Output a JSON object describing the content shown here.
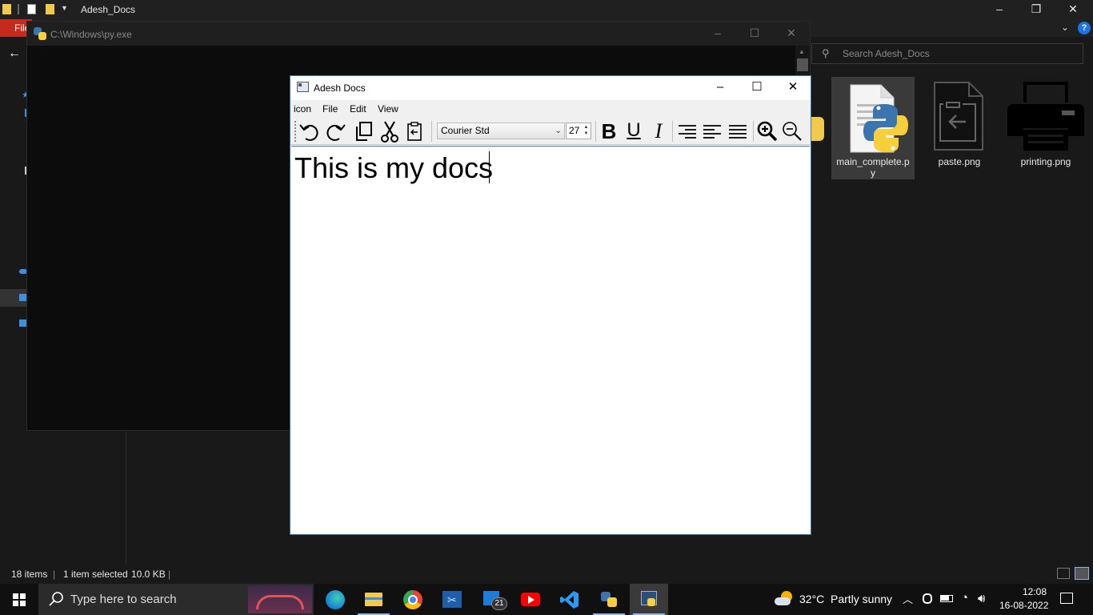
{
  "explorer": {
    "title": "Adesh_Docs",
    "file_tab": "File",
    "search_placeholder": "Search Adesh_Docs",
    "files": [
      {
        "name": "main_complete.py",
        "line1": "main_complete.p",
        "line2": "y",
        "selected": true
      },
      {
        "name": "paste.png",
        "line1": "paste.png",
        "line2": ""
      },
      {
        "name": "printing.png",
        "line1": "printing.png",
        "line2": ""
      }
    ],
    "status": {
      "items": "18 items",
      "selected": "1 item selected",
      "size": "10.0 KB"
    }
  },
  "console": {
    "title": "C:\\Windows\\py.exe"
  },
  "docs": {
    "title": "Adesh Docs",
    "menu": [
      "icon",
      "File",
      "Edit",
      "View"
    ],
    "font_family": "Courier Std",
    "font_size": "27",
    "content": "This is my docs"
  },
  "taskbar": {
    "search_placeholder": "Type here to search",
    "mail_badge": "21",
    "weather_temp": "32°C",
    "weather_desc": "Partly sunny",
    "time": "12:08",
    "date": "16-08-2022"
  },
  "colors": {
    "accent": "#3b78c0",
    "file_tab": "#c42b1c"
  }
}
